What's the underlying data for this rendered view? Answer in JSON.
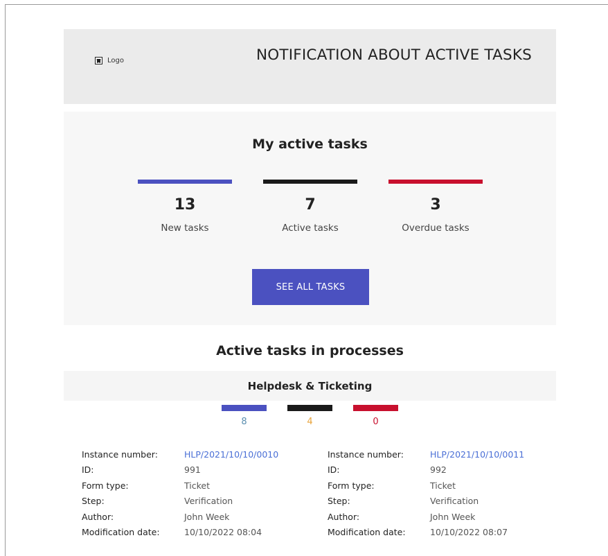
{
  "header": {
    "logo_text": "Logo",
    "title": "NOTIFICATION ABOUT ACTIVE TASKS"
  },
  "summary": {
    "title": "My active tasks",
    "stats": [
      {
        "count": "13",
        "label": "New tasks",
        "color": "#4b51c0"
      },
      {
        "count": "7",
        "label": "Active tasks",
        "color": "#1a1a1a"
      },
      {
        "count": "3",
        "label": "Overdue tasks",
        "color": "#c8102e"
      }
    ],
    "button_label": "SEE ALL TASKS"
  },
  "processes": {
    "title": "Active tasks in processes",
    "items": [
      {
        "name": "Helpdesk & Ticketing",
        "stats": [
          {
            "count": "8",
            "color": "#4b51c0",
            "text_color": "#5b8fb0"
          },
          {
            "count": "4",
            "color": "#1a1a1a",
            "text_color": "#e8a33a"
          },
          {
            "count": "0",
            "color": "#c8102e",
            "text_color": "#c8102e"
          }
        ],
        "tasks": [
          {
            "fields": [
              {
                "label": "Instance number:",
                "value": "HLP/2021/10/10/0010"
              },
              {
                "label": "ID:",
                "value": "991"
              },
              {
                "label": "Form type:",
                "value": "Ticket"
              },
              {
                "label": "Step:",
                "value": "Verification"
              },
              {
                "label": "Author:",
                "value": "John Week"
              },
              {
                "label": "Modification date:",
                "value": "10/10/2022 08:04"
              }
            ]
          },
          {
            "fields": [
              {
                "label": "Instance number:",
                "value": "HLP/2021/10/10/0011"
              },
              {
                "label": "ID:",
                "value": "992"
              },
              {
                "label": "Form type:",
                "value": "Ticket"
              },
              {
                "label": "Step:",
                "value": "Verification"
              },
              {
                "label": "Author:",
                "value": "John Week"
              },
              {
                "label": "Modification date:",
                "value": "10/10/2022 08:07"
              }
            ]
          }
        ]
      }
    ]
  }
}
